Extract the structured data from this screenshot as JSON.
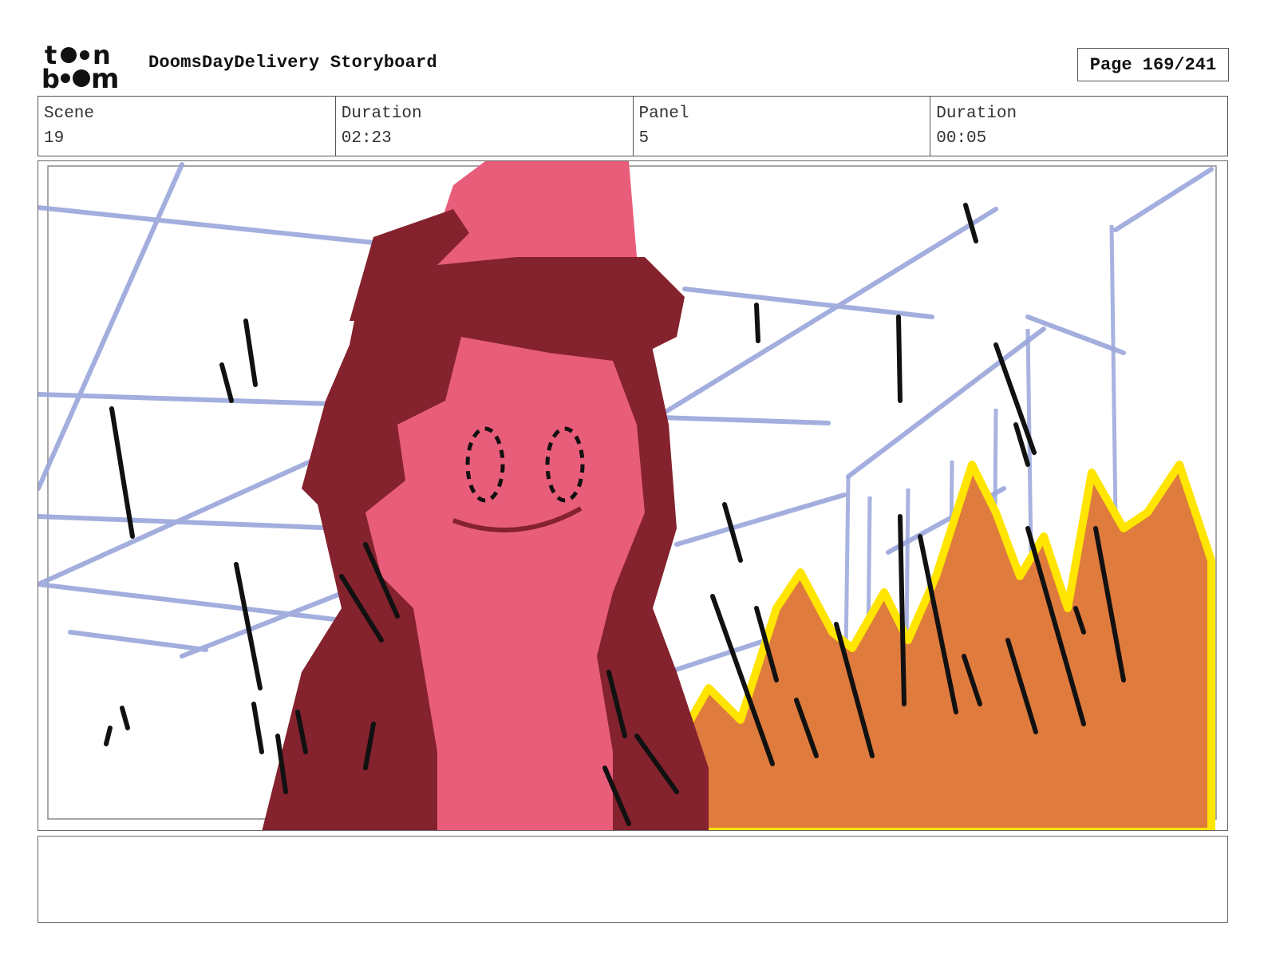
{
  "header": {
    "logo_text": "toon boom",
    "title": "DoomsDayDelivery Storyboard",
    "page": "Page 169/241"
  },
  "info": {
    "scene_label": "Scene",
    "scene_value": "19",
    "scene_duration_label": "Duration",
    "scene_duration_value": "02:23",
    "panel_label": "Panel",
    "panel_value": "5",
    "panel_duration_label": "Duration",
    "panel_duration_value": "00:05"
  },
  "notes": {
    "text": ""
  },
  "colors": {
    "character_light": "#e85d7a",
    "character_dark": "#84222d",
    "fire": "#e07b3e",
    "fire_edge": "#ffe500",
    "guides": "#9aa6db"
  }
}
